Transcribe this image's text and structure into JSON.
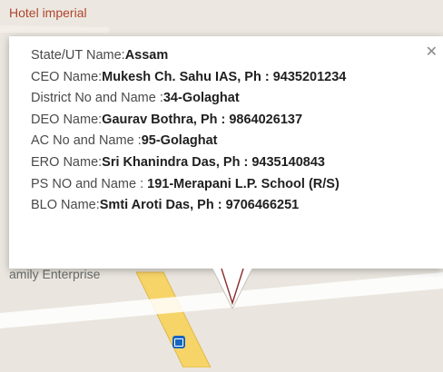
{
  "map": {
    "top_place": "Hotel imperial",
    "bottom_place": "amily Enterprise"
  },
  "popup": {
    "close_icon": "close-icon",
    "rows": [
      {
        "label": "State/UT Name:",
        "value": "Assam"
      },
      {
        "label": "CEO Name:",
        "value": "Mukesh Ch. Sahu IAS, Ph : 9435201234"
      },
      {
        "label": "District No and Name :",
        "value": "34-Golaghat"
      },
      {
        "label": "DEO Name:",
        "value": "Gaurav Bothra, Ph : 9864026137"
      },
      {
        "label": "AC No and Name :",
        "value": "95-Golaghat"
      },
      {
        "label": "ERO Name:",
        "value": "Sri Khanindra Das, Ph : 9435140843"
      },
      {
        "label": "PS NO and Name : ",
        "value": "191-Merapani L.P. School (R/S)"
      },
      {
        "label": "BLO Name:",
        "value": "Smti Aroti Das, Ph : 9706466251"
      }
    ]
  },
  "icons": {
    "transit": "bus-icon"
  }
}
